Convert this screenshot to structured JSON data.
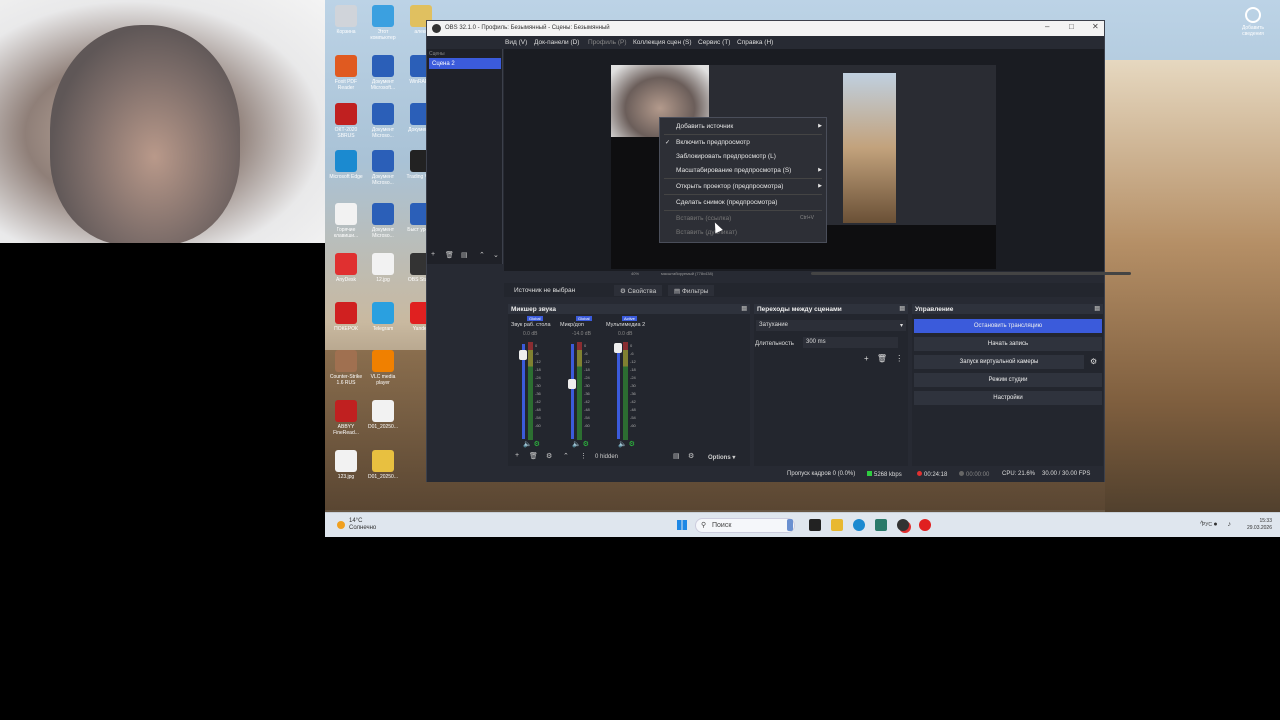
{
  "desktop": {
    "icons": [
      {
        "label": "Корзина",
        "color": "#d0d4da"
      },
      {
        "label": "Этот компьютер",
        "color": "#3ba0e0"
      },
      {
        "label": "алекс",
        "color": "#e0c060"
      },
      {
        "label": "Foxit PDF Reader",
        "color": "#e05a20"
      },
      {
        "label": "Документ Microsoft...",
        "color": "#2b5fb8"
      },
      {
        "label": "WinRAR...",
        "color": "#2b5fb8"
      },
      {
        "label": "ОКТ-2020 SBRUS",
        "color": "#c02020"
      },
      {
        "label": "Документ Microso...",
        "color": "#2b5fb8"
      },
      {
        "label": "Документ...",
        "color": "#2b5fb8"
      },
      {
        "label": "Microsoft Edge",
        "color": "#1b8ad0"
      },
      {
        "label": "Документ Microso...",
        "color": "#2b5fb8"
      },
      {
        "label": "Trading View",
        "color": "#222222"
      },
      {
        "label": "Горячие клавиши...",
        "color": "#f2f2f2"
      },
      {
        "label": "Документ Microso...",
        "color": "#2b5fb8"
      },
      {
        "label": "Быст урок...",
        "color": "#2b5fb8"
      },
      {
        "label": "AnyDesk",
        "color": "#e03030"
      },
      {
        "label": "12.jpg",
        "color": "#f2f2f2"
      },
      {
        "label": "OBS Studio",
        "color": "#333333"
      },
      {
        "label": "ПОКЕРОК",
        "color": "#d02020"
      },
      {
        "label": "Telegram",
        "color": "#2aa0e0"
      },
      {
        "label": "Yandex",
        "color": "#e02020"
      },
      {
        "label": "Counter-Strike 1.6 RUS",
        "color": "#a07050"
      },
      {
        "label": "VLC media player",
        "color": "#f08000"
      },
      {
        "label": "ABBYY FineRead...",
        "color": "#c02020"
      },
      {
        "label": "D01_20250...",
        "color": "#f2f2f2"
      },
      {
        "label": "123.jpg",
        "color": "#f2f2f2"
      },
      {
        "label": "D01_20250...",
        "color": "#e8c040"
      }
    ],
    "top_right_label": "Добавить сведения"
  },
  "taskbar": {
    "weather_temp": "14°C",
    "weather_desc": "Солнечно",
    "search_placeholder": "Поиск",
    "tray_lang": "РУС",
    "time": "15:33",
    "date": "29.03.2026"
  },
  "obs": {
    "title": "OBS 32.1.0 - Профиль: Безымянный - Сцены: Безымянный",
    "menu": [
      "Вид (V)",
      "Док-панели (D)",
      "Профиль (P)",
      "Коллекция сцен (S)",
      "Сервис (T)",
      "Справка (H)"
    ],
    "scenes_header": "Сцены",
    "scene_selected": "Сцена 2",
    "context_menu": {
      "add_source": "Добавить источник",
      "enable_preview": "Включить предпросмотр",
      "lock_preview": "Заблокировать предпросмотр (L)",
      "scale_preview": "Масштабирование предпросмотра (S)",
      "open_projector": "Открыть проектор (предпросмотра)",
      "screenshot": "Сделать снимок (предпросмотра)",
      "paste_ref": "Вставить (ссылка)",
      "paste_ref_shortcut": "Ctrl+V",
      "paste_dup": "Вставить (дубликат)"
    },
    "preview_zoom": "40%",
    "preview_scale_label": "масштабируемый (778x438)",
    "no_source": "Источник не выбран",
    "properties_btn": "Свойства",
    "filters_btn": "Фильтры",
    "mixer": {
      "title": "Микшер звука",
      "channels": [
        {
          "badge": "Global",
          "name": "Звук раб. стола",
          "db": "0.0 dB",
          "level": 0.12
        },
        {
          "badge": "Global",
          "name": "Микр/доп",
          "db": "-14.0 dB",
          "level": 0.42
        },
        {
          "badge": "Active",
          "name": "Мультимедиа 2",
          "db": "0.0 dB",
          "level": 0.04
        }
      ],
      "scale": [
        "0",
        "-6",
        "-12",
        "-18",
        "-24",
        "-30",
        "-36",
        "-42",
        "-48",
        "-54",
        "-60"
      ],
      "hidden": "0 hidden",
      "options": "Options"
    },
    "transitions": {
      "title": "Переходы между сценами",
      "selected": "Затухание",
      "duration_label": "Длительность",
      "duration": "300 ms"
    },
    "controls": {
      "title": "Управление",
      "stop_stream": "Остановить трансляцию",
      "start_record": "Начать запись",
      "virtual_cam": "Запуск виртуальной камеры",
      "studio_mode": "Режим студии",
      "settings": "Настройки"
    },
    "status": {
      "dropped": "Пропуск кадров 0 (0.0%)",
      "bitrate": "5268 kbps",
      "stream_time": "00:24:18",
      "rec_time": "00:00:00",
      "cpu": "CPU: 21.6%",
      "fps": "30.00 / 30.00 FPS"
    },
    "colors": {
      "accent": "#3b5bdb",
      "live": "#e03030",
      "ok": "#2ecc40"
    }
  }
}
